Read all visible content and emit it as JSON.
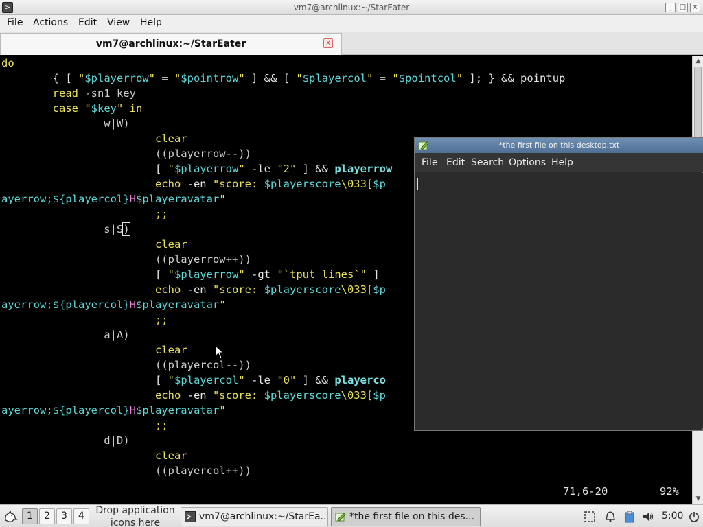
{
  "terminal": {
    "window_title": "vm7@archlinux:~/StarEater",
    "menu": [
      "File",
      "Actions",
      "Edit",
      "View",
      "Help"
    ],
    "tab_label": "vm7@archlinux:~/StarEater",
    "tab_close": "x",
    "status_position": "71,6-20",
    "status_percent": "92%",
    "lines": [
      [
        {
          "t": "do",
          "c": "kw"
        }
      ],
      [
        {
          "t": "        { [ ",
          "c": "op"
        },
        {
          "t": "\"",
          "c": "str"
        },
        {
          "t": "$playerrow",
          "c": "var"
        },
        {
          "t": "\"",
          "c": "str"
        },
        {
          "t": " = ",
          "c": "op"
        },
        {
          "t": "\"",
          "c": "str"
        },
        {
          "t": "$pointrow",
          "c": "var"
        },
        {
          "t": "\"",
          "c": "str"
        },
        {
          "t": " ] && [ ",
          "c": "op"
        },
        {
          "t": "\"",
          "c": "str"
        },
        {
          "t": "$playercol",
          "c": "var"
        },
        {
          "t": "\"",
          "c": "str"
        },
        {
          "t": " = ",
          "c": "op"
        },
        {
          "t": "\"",
          "c": "str"
        },
        {
          "t": "$pointcol",
          "c": "var"
        },
        {
          "t": "\"",
          "c": "str"
        },
        {
          "t": " ]; } && pointup",
          "c": "op"
        }
      ],
      [
        {
          "t": "        ",
          "c": "op"
        },
        {
          "t": "read",
          "c": "kw"
        },
        {
          "t": " -sn1 key",
          "c": "dim"
        }
      ],
      [
        {
          "t": "        ",
          "c": "op"
        },
        {
          "t": "case",
          "c": "kw"
        },
        {
          "t": " ",
          "c": "op"
        },
        {
          "t": "\"",
          "c": "str"
        },
        {
          "t": "$key",
          "c": "var"
        },
        {
          "t": "\"",
          "c": "str"
        },
        {
          "t": " ",
          "c": "op"
        },
        {
          "t": "in",
          "c": "kw"
        }
      ],
      [
        {
          "t": "                w|W)",
          "c": "dim"
        }
      ],
      [
        {
          "t": "                        ",
          "c": "op"
        },
        {
          "t": "clear",
          "c": "kw"
        }
      ],
      [
        {
          "t": "                        ((playerrow--))",
          "c": "dim"
        }
      ],
      [
        {
          "t": "                        [ ",
          "c": "op"
        },
        {
          "t": "\"",
          "c": "str"
        },
        {
          "t": "$playerrow",
          "c": "var"
        },
        {
          "t": "\"",
          "c": "str"
        },
        {
          "t": " -le ",
          "c": "op"
        },
        {
          "t": "\"2\"",
          "c": "str"
        },
        {
          "t": " ] && ",
          "c": "op"
        },
        {
          "t": "playerrow",
          "c": "bold"
        }
      ],
      [
        {
          "t": "                        ",
          "c": "op"
        },
        {
          "t": "echo",
          "c": "kw"
        },
        {
          "t": " -en ",
          "c": "op"
        },
        {
          "t": "\"score: ",
          "c": "str"
        },
        {
          "t": "$playerscore",
          "c": "var"
        },
        {
          "t": "\\033[",
          "c": "str"
        },
        {
          "t": "$p",
          "c": "var"
        }
      ],
      [
        {
          "t": "ayerrow;",
          "c": "var"
        },
        {
          "t": "${playercol}",
          "c": "var"
        },
        {
          "t": "H",
          "c": "esc"
        },
        {
          "t": "$playeravatar",
          "c": "var"
        },
        {
          "t": "\"",
          "c": "str"
        }
      ],
      [
        {
          "t": "                        ;;",
          "c": "kw"
        }
      ],
      [
        {
          "t": "                s|S",
          "c": "dim"
        },
        {
          "t": ")",
          "c": "cursor"
        }
      ],
      [
        {
          "t": "                        ",
          "c": "op"
        },
        {
          "t": "clear",
          "c": "kw"
        }
      ],
      [
        {
          "t": "                        ((playerrow++))",
          "c": "dim"
        }
      ],
      [
        {
          "t": "                        [ ",
          "c": "op"
        },
        {
          "t": "\"",
          "c": "str"
        },
        {
          "t": "$playerrow",
          "c": "var"
        },
        {
          "t": "\"",
          "c": "str"
        },
        {
          "t": " -gt ",
          "c": "op"
        },
        {
          "t": "\"`tput lines`\"",
          "c": "str"
        },
        {
          "t": " ]",
          "c": "op"
        }
      ],
      [
        {
          "t": "                        ",
          "c": "op"
        },
        {
          "t": "echo",
          "c": "kw"
        },
        {
          "t": " -en ",
          "c": "op"
        },
        {
          "t": "\"score: ",
          "c": "str"
        },
        {
          "t": "$playerscore",
          "c": "var"
        },
        {
          "t": "\\033[",
          "c": "str"
        },
        {
          "t": "$p",
          "c": "var"
        }
      ],
      [
        {
          "t": "ayerrow;",
          "c": "var"
        },
        {
          "t": "${playercol}",
          "c": "var"
        },
        {
          "t": "H",
          "c": "esc"
        },
        {
          "t": "$playeravatar",
          "c": "var"
        },
        {
          "t": "\"",
          "c": "str"
        }
      ],
      [
        {
          "t": "                        ;;",
          "c": "kw"
        }
      ],
      [
        {
          "t": "                a|A)",
          "c": "dim"
        }
      ],
      [
        {
          "t": "                        ",
          "c": "op"
        },
        {
          "t": "clear",
          "c": "kw"
        }
      ],
      [
        {
          "t": "                        ((playercol--))",
          "c": "dim"
        }
      ],
      [
        {
          "t": "                        [ ",
          "c": "op"
        },
        {
          "t": "\"",
          "c": "str"
        },
        {
          "t": "$playercol",
          "c": "var"
        },
        {
          "t": "\"",
          "c": "str"
        },
        {
          "t": " -le ",
          "c": "op"
        },
        {
          "t": "\"0\"",
          "c": "str"
        },
        {
          "t": " ] && ",
          "c": "op"
        },
        {
          "t": "playerco",
          "c": "bold"
        }
      ],
      [
        {
          "t": "                        ",
          "c": "op"
        },
        {
          "t": "echo",
          "c": "kw"
        },
        {
          "t": " -en ",
          "c": "op"
        },
        {
          "t": "\"score: ",
          "c": "str"
        },
        {
          "t": "$playerscore",
          "c": "var"
        },
        {
          "t": "\\033[",
          "c": "str"
        },
        {
          "t": "$p",
          "c": "var"
        }
      ],
      [
        {
          "t": "ayerrow;",
          "c": "var"
        },
        {
          "t": "${playercol}",
          "c": "var"
        },
        {
          "t": "H",
          "c": "esc"
        },
        {
          "t": "$playeravatar",
          "c": "var"
        },
        {
          "t": "\"",
          "c": "str"
        }
      ],
      [
        {
          "t": "                        ;;",
          "c": "kw"
        }
      ],
      [
        {
          "t": "                d|D)",
          "c": "dim"
        }
      ],
      [
        {
          "t": "                        ",
          "c": "op"
        },
        {
          "t": "clear",
          "c": "kw"
        }
      ],
      [
        {
          "t": "                        ((playercol++))",
          "c": "dim"
        }
      ]
    ]
  },
  "editor": {
    "window_title": "*the first file on this desktop.txt",
    "menu": [
      "File",
      "Edit",
      "Search",
      "Options",
      "Help"
    ]
  },
  "taskbar": {
    "workspaces": [
      "1",
      "2",
      "3",
      "4"
    ],
    "active_workspace": "1",
    "drop_hint": "Drop application icons here",
    "tasks": [
      {
        "label": "vm7@archlinux:~/StarEa...",
        "icon": "terminal-icon"
      },
      {
        "label": "*the first file on this des...",
        "icon": "text-editor-icon"
      }
    ],
    "clock": "5:00"
  },
  "colors": {
    "terminal_bg": "#000000",
    "keyword": "#e9e05a",
    "variable": "#5fd7d7",
    "escape": "#e67ed6",
    "editor_titlebar": "#5a7aa3"
  }
}
